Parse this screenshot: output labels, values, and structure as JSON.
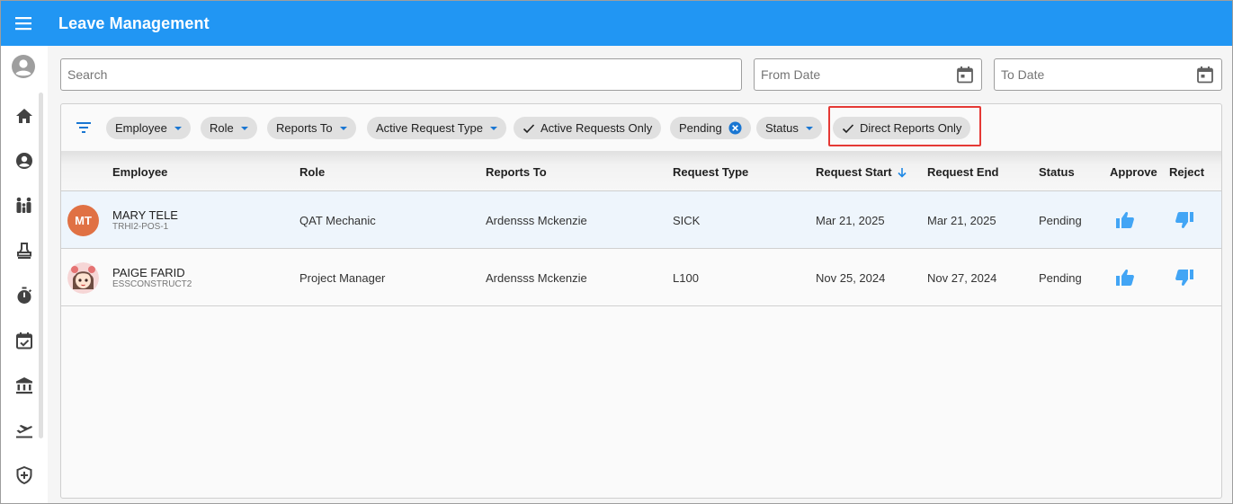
{
  "app": {
    "title": "Leave Management"
  },
  "search": {
    "placeholder": "Search"
  },
  "from_date": {
    "placeholder": "From Date"
  },
  "to_date": {
    "placeholder": "To Date"
  },
  "filters": {
    "employee": "Employee",
    "role": "Role",
    "reports_to": "Reports To",
    "active_request_type": "Active Request Type",
    "active_requests_only": "Active Requests Only",
    "pending": "Pending",
    "status": "Status",
    "direct_reports_only": "Direct Reports Only"
  },
  "columns": {
    "employee": "Employee",
    "role": "Role",
    "reports_to": "Reports To",
    "request_type": "Request Type",
    "request_start": "Request Start",
    "request_end": "Request End",
    "status": "Status",
    "approve": "Approve",
    "reject": "Reject"
  },
  "rows": [
    {
      "initials": "MT",
      "name": "MARY TELE",
      "code": "TRHI2-POS-1",
      "role": "QAT Mechanic",
      "reports_to": "Ardensss Mckenzie",
      "request_type": "SICK",
      "request_start": "Mar 21, 2025",
      "request_end": "Mar 21, 2025",
      "status": "Pending"
    },
    {
      "name": "PAIGE FARID",
      "code": "ESSCONSTRUCT2",
      "role": "Project Manager",
      "reports_to": "Ardensss Mckenzie",
      "request_type": "L100",
      "request_start": "Nov 25, 2024",
      "request_end": "Nov 27, 2024",
      "status": "Pending"
    }
  ],
  "colors": {
    "topbar": "#2196f3",
    "accent": "#1976d2",
    "thumb": "#42a5f5",
    "avatar_initials_bg": "#e07144",
    "highlight": "#e53935"
  },
  "icons": {
    "menu": "menu-icon",
    "home": "home-icon",
    "profile": "account-circle-icon",
    "team": "family-icon",
    "stamp": "stamp-icon",
    "timer": "timer-icon",
    "calendar_check": "calendar-check-icon",
    "bank": "bank-icon",
    "travel": "flight-takeoff-icon",
    "health": "shield-plus-icon",
    "filter": "filter-icon",
    "approve": "thumb-up-icon",
    "reject": "thumb-down-icon"
  }
}
